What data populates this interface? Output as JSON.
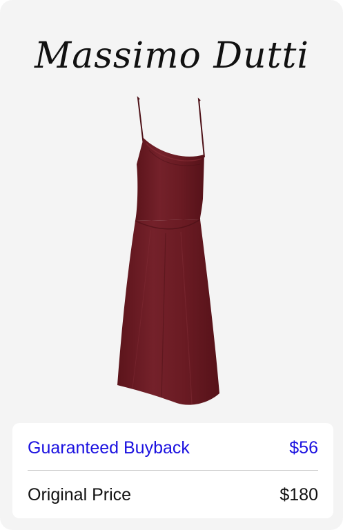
{
  "brand": {
    "name": "Massimo Dutti"
  },
  "product": {
    "image_icon": "slip-dress-image",
    "color": "#6e1b22"
  },
  "pricing": {
    "buyback_label": "Guaranteed Buyback",
    "buyback_value": "$56",
    "original_label": "Original Price",
    "original_value": "$180"
  },
  "colors": {
    "buyback_accent": "#1a10e0",
    "card_background": "#f4f4f4",
    "panel_background": "#ffffff"
  }
}
